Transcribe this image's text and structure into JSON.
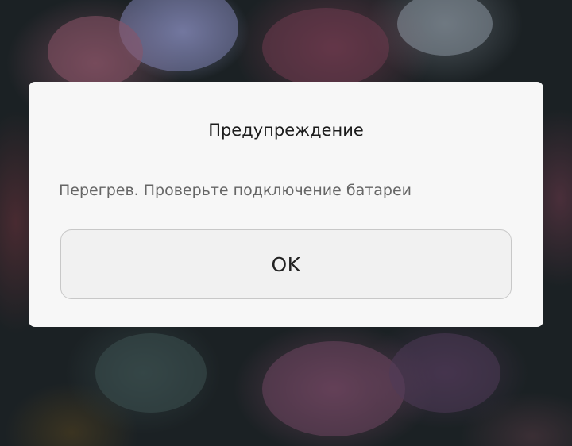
{
  "dialog": {
    "title": "Предупреждение",
    "message": "Перегрев. Проверьте подключение батареи",
    "ok_label": "OK"
  },
  "colors": {
    "dialog_background": "#f7f7f7",
    "title_text": "#1c1c1c",
    "message_text": "#666666",
    "button_background": "#f1f1f1",
    "button_border": "#c8c8c8"
  },
  "background": {
    "description_icon": "flower-wallpaper-image"
  }
}
